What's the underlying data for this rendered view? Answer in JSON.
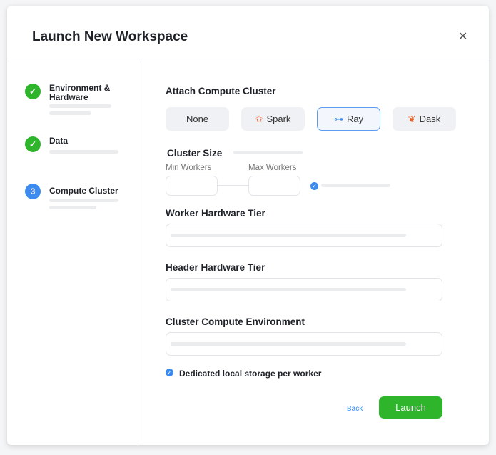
{
  "title": "Launch New Workspace",
  "steps": [
    {
      "label": "Environment & Hardware",
      "state": "done"
    },
    {
      "label": "Data",
      "state": "done"
    },
    {
      "label": "Compute Cluster",
      "number": "3",
      "state": "current"
    }
  ],
  "attach": {
    "heading": "Attach Compute Cluster",
    "options": [
      "None",
      "Spark",
      "Ray",
      "Dask"
    ],
    "selected": "Ray"
  },
  "cluster_size": {
    "heading": "Cluster Size",
    "min_label": "Min Workers",
    "max_label": "Max Workers",
    "min_value": "",
    "max_value": ""
  },
  "worker_tier": "Worker Hardware Tier",
  "header_tier": "Header Hardware Tier",
  "environment": "Cluster Compute Environment",
  "storage_label": "Dedicated local storage per worker",
  "back": "Back",
  "launch": "Launch",
  "colors": {
    "green": "#2eb52b",
    "blue": "#3d8bef",
    "spark": "#e8622c"
  }
}
